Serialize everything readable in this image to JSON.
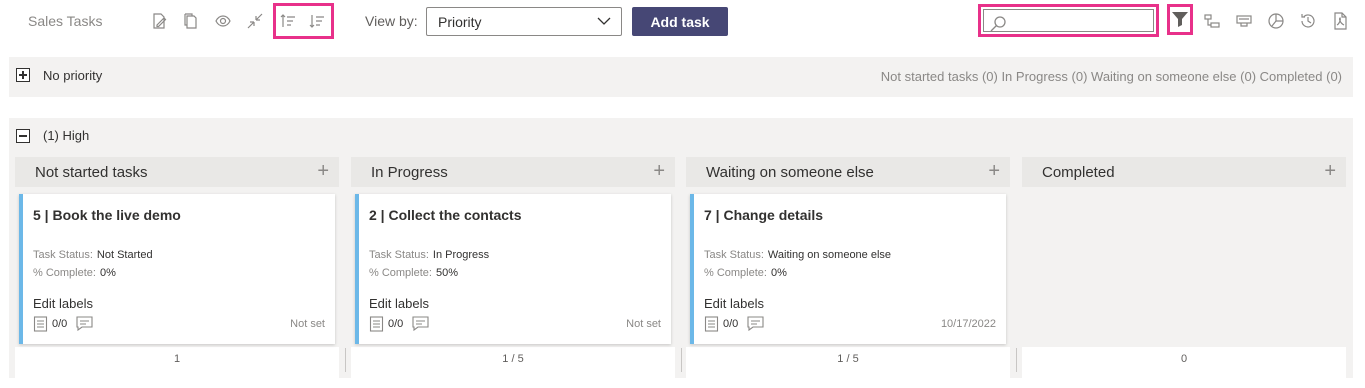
{
  "toolbar": {
    "title": "Sales Tasks",
    "icons": [
      "edit-icon",
      "copy-icon",
      "view-icon",
      "collapse-icon",
      "sort-ascending-icon",
      "sort-descending-icon"
    ],
    "view_by_label": "View by:",
    "view_by_value": "Priority",
    "add_task_label": "Add task",
    "search_value": "",
    "right_icons": [
      "filter-icon",
      "hierarchy-icon",
      "card-view-icon",
      "chart-icon",
      "history-icon",
      "pdf-icon"
    ],
    "highlight_color": "#e8318a",
    "accent_color": "#464775"
  },
  "groups": [
    {
      "title": "No priority",
      "expanded": false,
      "summary": "Not started tasks (0)   In Progress (0)   Waiting on someone else (0)   Completed (0)"
    },
    {
      "title": "(1) High",
      "expanded": true,
      "columns": [
        {
          "title": "Not started tasks",
          "card": {
            "title": "5 | Book the live demo",
            "status_label": "Task Status:",
            "status_value": "Not Started",
            "complete_label": "% Complete:",
            "complete_value": "0%",
            "labels_text": "Edit labels",
            "checklist": "0/0",
            "due": "Not set"
          },
          "pager": "1"
        },
        {
          "title": "In Progress",
          "card": {
            "title": "2 | Collect the contacts",
            "status_label": "Task Status:",
            "status_value": "In Progress",
            "complete_label": "% Complete:",
            "complete_value": "50%",
            "labels_text": "Edit labels",
            "checklist": "0/0",
            "due": "Not set"
          },
          "pager": "1 / 5"
        },
        {
          "title": "Waiting on someone else",
          "card": {
            "title": "7 | Change details",
            "status_label": "Task Status:",
            "status_value": "Waiting on someone else",
            "complete_label": "% Complete:",
            "complete_value": "0%",
            "labels_text": "Edit labels",
            "checklist": "0/0",
            "due": "10/17/2022"
          },
          "pager": "1 / 5"
        },
        {
          "title": "Completed",
          "card": null,
          "pager": "0"
        }
      ]
    }
  ],
  "card_accent_color": "#6cb8e8"
}
